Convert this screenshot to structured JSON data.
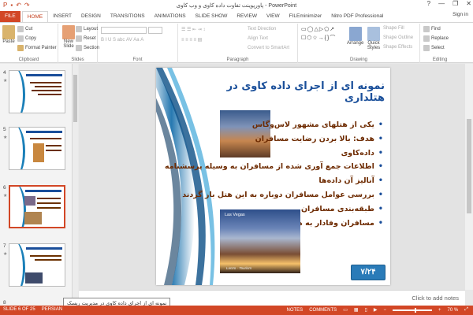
{
  "window": {
    "title": "پاورپوینت تفاوت داده کاوی و وب کاوی - PowerPoint",
    "signin": "Sign in",
    "controls": [
      "?",
      "—",
      "❐",
      "✕"
    ]
  },
  "tabs": [
    {
      "label": "FILE"
    },
    {
      "label": "HOME"
    },
    {
      "label": "INSERT"
    },
    {
      "label": "DESIGN"
    },
    {
      "label": "TRANSITIONS"
    },
    {
      "label": "ANIMATIONS"
    },
    {
      "label": "SLIDE SHOW"
    },
    {
      "label": "REVIEW"
    },
    {
      "label": "VIEW"
    },
    {
      "label": "FILEminimizer"
    },
    {
      "label": "Nitro PDF Professional"
    }
  ],
  "ribbon": {
    "clipboard": {
      "label": "Clipboard",
      "paste": "Paste",
      "cut": "Cut",
      "copy": "Copy",
      "format_painter": "Format Painter"
    },
    "slides": {
      "label": "Slides",
      "new_slide": "New Slide",
      "layout": "Layout",
      "reset": "Reset",
      "section": "Section"
    },
    "font": {
      "label": "Font"
    },
    "paragraph": {
      "label": "Paragraph",
      "text_direction": "Text Direction",
      "align_text": "Align Text",
      "convert_smartart": "Convert to SmartArt"
    },
    "drawing": {
      "label": "Drawing",
      "arrange": "Arrange",
      "quick_styles": "Quick Styles",
      "shape_fill": "Shape Fill",
      "shape_outline": "Shape Outline",
      "shape_effects": "Shape Effects"
    },
    "editing": {
      "label": "Editing",
      "find": "Find",
      "replace": "Replace",
      "select": "Select"
    }
  },
  "thumbnails": [
    {
      "number": "4",
      "star": "★"
    },
    {
      "number": "5",
      "star": "★"
    },
    {
      "number": "6",
      "star": "★"
    },
    {
      "number": "7",
      "star": "★"
    },
    {
      "number": "8"
    }
  ],
  "slide": {
    "title": "نمونه ای از اجرای داده کاوی در هتلداری",
    "bullets": [
      "یکی از هتلهای مشهور لاس‌وگاس",
      "هدف: بالا بردن رضایت مسافران",
      "داده‌کاوی",
      "اطلاعات جمع آوری شده از مسافران به وسیله پرسشنامه",
      "آنالیز آن داده‌ها",
      "بررسی عوامل مسافران دوباره به این هتل باز گردند",
      "طبقه‌بندی مسافران",
      "مسافران وفادار به هتل"
    ],
    "image_caption": "Las Vegas",
    "image_credit": "Lanzo · Tourism",
    "page_label": "۷/۲۴"
  },
  "notes_placeholder": "Click to add notes",
  "tooltip": "نمونه ای از اجرای داده کاوی در مدیریت ریسک",
  "status": {
    "slide_info": "SLIDE 6 OF 25",
    "language": "PERSIAN",
    "notes": "NOTES",
    "comments": "COMMENTS",
    "zoom": "70 %"
  },
  "colors": {
    "accent": "#d24726",
    "title_blue": "#1a4f9a",
    "bullet_brown": "#6d2a00",
    "page_box": "#2a7bb8"
  }
}
